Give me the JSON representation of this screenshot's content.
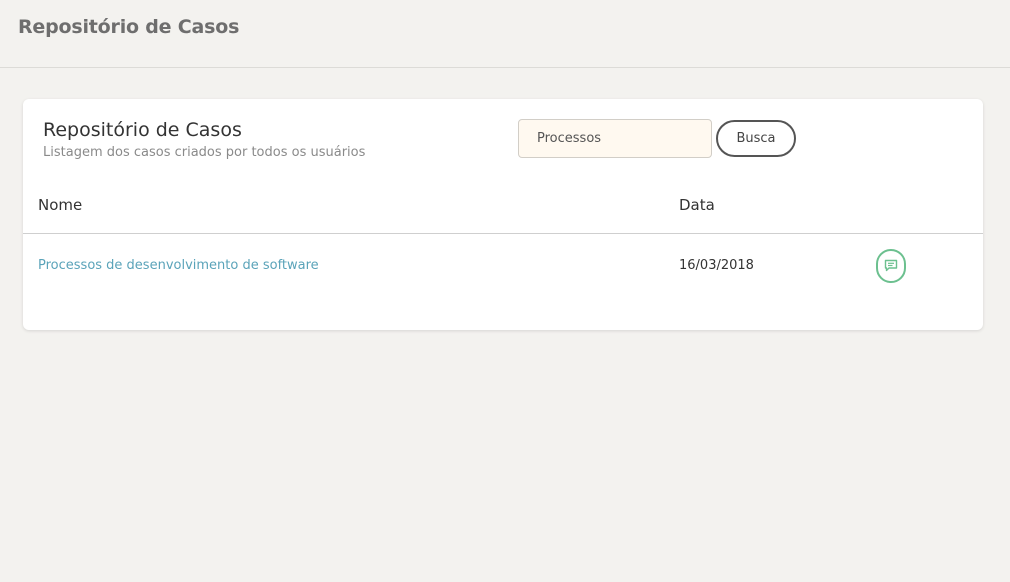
{
  "header": {
    "title": "Repositório de Casos"
  },
  "card": {
    "title": "Repositório de Casos",
    "subtitle": "Listagem dos casos criados por todos os usuários",
    "search": {
      "value": "Processos",
      "placeholder": "",
      "button_label": "Busca"
    },
    "table": {
      "columns": [
        "Nome",
        "Data"
      ],
      "rows": [
        {
          "name": "Processos de desenvolvimento de software",
          "date": "16/03/2018",
          "action_icon": "comment-icon"
        }
      ]
    }
  },
  "colors": {
    "background": "#f3f2ef",
    "link": "#5aa3b9",
    "action_accent": "#6cc08f",
    "input_bg": "#fff9f0"
  }
}
